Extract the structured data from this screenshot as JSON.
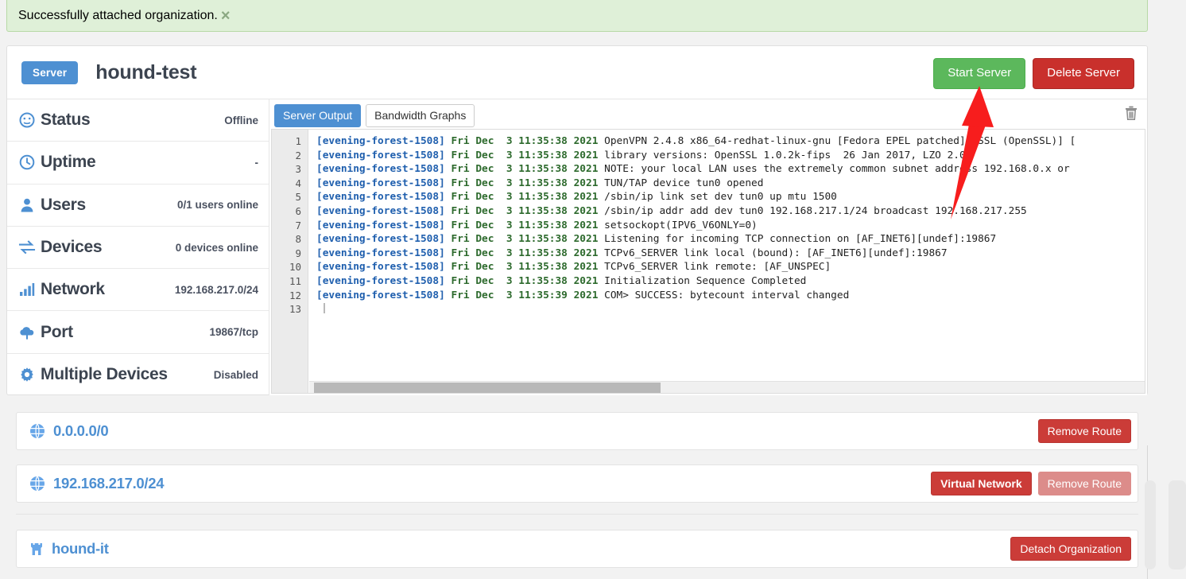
{
  "alert": {
    "message": "Successfully attached organization.",
    "close_label": "×",
    "bg_color": "#dff0d8",
    "text_color": "#3c763d"
  },
  "header": {
    "badge": "Server",
    "title": "hound-test",
    "start_button": "Start Server",
    "delete_button": "Delete Server",
    "start_color": "#5cb85c",
    "delete_color": "#c9302c"
  },
  "sidebar": {
    "items": [
      {
        "icon": "speedometer-icon",
        "label": "Status",
        "value": "Offline"
      },
      {
        "icon": "clock-icon",
        "label": "Uptime",
        "value": "-"
      },
      {
        "icon": "user-icon",
        "label": "Users",
        "value": "0/1 users online"
      },
      {
        "icon": "exchange-icon",
        "label": "Devices",
        "value": "0 devices online"
      },
      {
        "icon": "signal-icon",
        "label": "Network",
        "value": "192.168.217.0/24"
      },
      {
        "icon": "cloud-upload-icon",
        "label": "Port",
        "value": "19867/tcp"
      },
      {
        "icon": "gear-icon",
        "label": "Multiple Devices",
        "value": "Disabled"
      }
    ]
  },
  "log_panel": {
    "tabs": [
      {
        "label": "Server Output",
        "active": true
      },
      {
        "label": "Bandwidth Graphs",
        "active": false
      }
    ],
    "clear_icon": "trash-icon",
    "host": "[evening-forest-1508]",
    "lines": [
      {
        "num": "1",
        "date": "Fri Dec  3 11:35:38 2021",
        "text": "OpenVPN 2.4.8 x86_64-redhat-linux-gnu [Fedora EPEL patched] [SSL (OpenSSL)] ["
      },
      {
        "num": "2",
        "date": "Fri Dec  3 11:35:38 2021",
        "text": "library versions: OpenSSL 1.0.2k-fips  26 Jan 2017, LZO 2.06"
      },
      {
        "num": "3",
        "date": "Fri Dec  3 11:35:38 2021",
        "text": "NOTE: your local LAN uses the extremely common subnet address 192.168.0.x or"
      },
      {
        "num": "4",
        "date": "Fri Dec  3 11:35:38 2021",
        "text": "TUN/TAP device tun0 opened"
      },
      {
        "num": "5",
        "date": "Fri Dec  3 11:35:38 2021",
        "text": "/sbin/ip link set dev tun0 up mtu 1500"
      },
      {
        "num": "6",
        "date": "Fri Dec  3 11:35:38 2021",
        "text": "/sbin/ip addr add dev tun0 192.168.217.1/24 broadcast 192.168.217.255"
      },
      {
        "num": "7",
        "date": "Fri Dec  3 11:35:38 2021",
        "text": "setsockopt(IPV6_V6ONLY=0)"
      },
      {
        "num": "8",
        "date": "Fri Dec  3 11:35:38 2021",
        "text": "Listening for incoming TCP connection on [AF_INET6][undef]:19867"
      },
      {
        "num": "9",
        "date": "Fri Dec  3 11:35:38 2021",
        "text": "TCPv6_SERVER link local (bound): [AF_INET6][undef]:19867"
      },
      {
        "num": "10",
        "date": "Fri Dec  3 11:35:38 2021",
        "text": "TCPv6_SERVER link remote: [AF_UNSPEC]"
      },
      {
        "num": "11",
        "date": "Fri Dec  3 11:35:38 2021",
        "text": "Initialization Sequence Completed"
      },
      {
        "num": "12",
        "date": "Fri Dec  3 11:35:39 2021",
        "text": "COM> SUCCESS: bytecount interval changed"
      },
      {
        "num": "13",
        "date": "",
        "text": ""
      }
    ],
    "host_color": "#1f5fae",
    "date_color": "#2d6a2d"
  },
  "routes": [
    {
      "icon": "globe-icon",
      "name": "0.0.0.0/0",
      "buttons": [
        {
          "label": "Remove Route",
          "style": "danger"
        }
      ]
    },
    {
      "icon": "globe-icon",
      "name": "192.168.217.0/24",
      "buttons": [
        {
          "label": "Virtual Network",
          "style": "danger-bold"
        },
        {
          "label": "Remove Route",
          "style": "danger-muted"
        }
      ]
    }
  ],
  "organization": {
    "icon": "org-icon",
    "name": "hound-it",
    "buttons": [
      {
        "label": "Detach Organization",
        "style": "danger"
      }
    ]
  },
  "annotation": {
    "type": "arrow",
    "color": "#f71d1d",
    "points_to": "start-server-button"
  }
}
